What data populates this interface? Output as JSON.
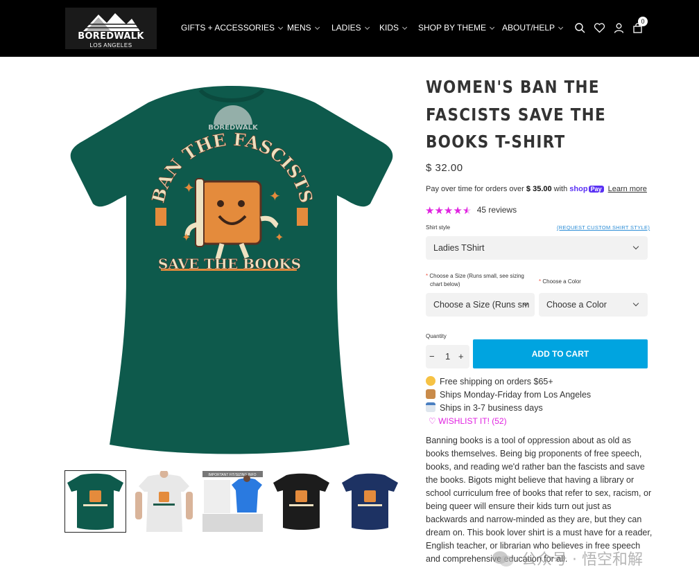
{
  "header": {
    "logo_name": "BOREDWALK",
    "logo_sub": "LOS ANGELES",
    "nav": [
      {
        "label": "GIFTS + ACCESSORIES"
      },
      {
        "label": "MENS"
      },
      {
        "label": "LADIES"
      },
      {
        "label": "KIDS"
      },
      {
        "label": "SHOP BY THEME"
      },
      {
        "label": "ABOUT/HELP"
      }
    ],
    "icons": [
      "search-icon",
      "heart-icon",
      "account-icon",
      "cart-icon"
    ],
    "cart_count": "0"
  },
  "product": {
    "title": "WOMEN'S BAN THE FASCISTS SAVE THE BOOKS T-SHIRT",
    "shirt_text_top": "BAN THE FASCISTS",
    "shirt_text_bottom": "SAVE THE BOOKS",
    "shirt_brand": "BOREDWALK",
    "price": "$ 32.00",
    "pay": {
      "prefix": "Pay over time for orders over",
      "amount": "$ 35.00",
      "with": "with",
      "shop": "shop",
      "pay_badge": "Pay",
      "learn_more": "Learn more"
    },
    "rating": {
      "stars": 4.5,
      "reviews": "45 reviews",
      "color": "#e023e0"
    },
    "shirt_style": {
      "label": "Shirt style",
      "custom_link": "(REQUEST CUSTOM SHIRT STYLE)",
      "value": "Ladies TShirt"
    },
    "size": {
      "label_line1": "Choose a Size (Runs small, see sizing",
      "label_line2": "chart below)",
      "value": "Choose a Size (Runs sm"
    },
    "color": {
      "label": "Choose a Color",
      "value": "Choose a Color"
    },
    "quantity": {
      "label": "Quantity",
      "minus": "−",
      "value": "1",
      "plus": "+"
    },
    "add_to_cart": "ADD TO CART",
    "info": [
      {
        "icon": "heart-eyes-emoji-icon",
        "text": "Free shipping on orders $65+"
      },
      {
        "icon": "package-emoji-icon",
        "text": "Ships Monday-Friday from Los Angeles"
      },
      {
        "icon": "calendar-emoji-icon",
        "text": "Ships in 3-7 business days"
      }
    ],
    "wishlist": "WISHLIST IT! (52)",
    "description": "Banning books is a tool of oppression about as old as books themselves. Being big proponents of free speech, books, and reading we'd rather ban the fascists and save the books. Bigots might believe that having a library or school curriculum free of books that refer to sex, racism, or being queer will ensure their kids turn out just as backwards and narrow-minded as they are, but they can dream on. This book lover shirt is a must have for a reader, English teacher, or librarian who believes in free speech and comprehensive education for all.",
    "thumb_notice": "IMPORTANT FIT/SIZING INFO"
  },
  "colors": {
    "header_bg": "#000000",
    "accent_blue": "#00a4e0",
    "teal_shirt": "#0e5a4c",
    "white_shirt": "#e8e8e8",
    "black_shirt": "#1c1c1c",
    "navy_shirt": "#1d3263"
  },
  "watermark": "公众号 · 悟空和解"
}
